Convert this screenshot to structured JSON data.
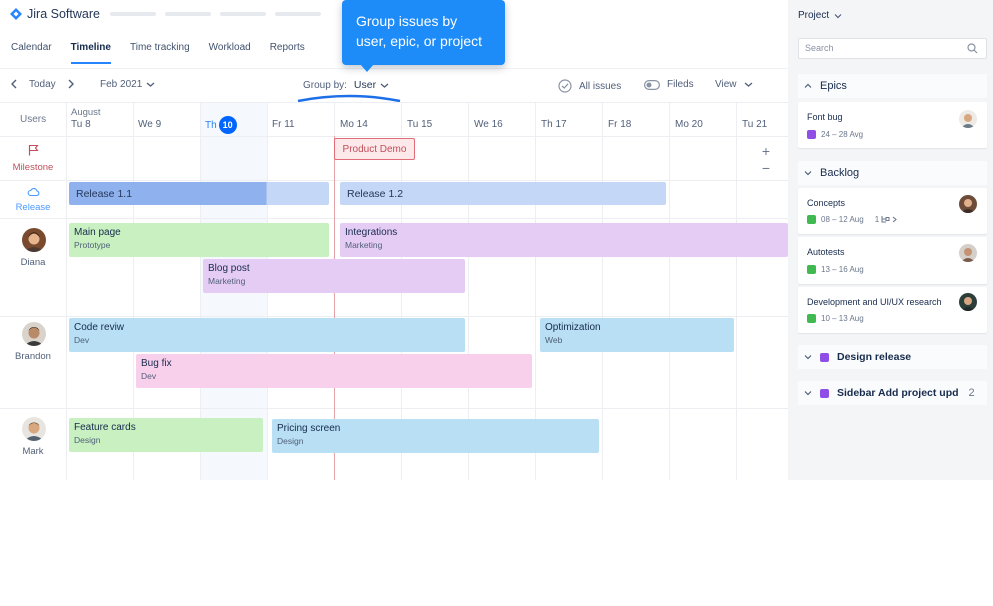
{
  "app": {
    "title": "Jira Software"
  },
  "nav": {
    "tabs": [
      "Calendar",
      "Timeline",
      "Time tracking",
      "Workload",
      "Reports"
    ],
    "active": "Timeline"
  },
  "toolbar": {
    "today": "Today",
    "month": "Feb 2021",
    "group_by_label": "Group by:",
    "group_by_value": "User",
    "all_issues": "All issues",
    "fields": "Fileds",
    "view": "View"
  },
  "tooltip": {
    "text": "Group issues by user, epic, or project"
  },
  "timeline": {
    "users_header": "Users",
    "month_label": "August",
    "days": [
      "Tu 8",
      "We 9",
      "Th",
      "Fr 11",
      "Mo 14",
      "Tu 15",
      "We 16",
      "Th 17",
      "Fr 18",
      "Mo 20",
      "Tu 21"
    ],
    "today_number": "10",
    "milestone_label": "Milestone",
    "release_label": "Release",
    "milestone_name": "Product Demo",
    "zoom_in": "+",
    "zoom_out": "−",
    "releases": [
      "Release 1.1",
      "Release 1.2"
    ],
    "users": [
      "Diana",
      "Brandon",
      "Mark"
    ],
    "bars": [
      {
        "title": "Main page",
        "sub": "Prototype"
      },
      {
        "title": "Integrations",
        "sub": "Marketing"
      },
      {
        "title": "Blog post",
        "sub": "Marketing"
      },
      {
        "title": "Code reviw",
        "sub": "Dev"
      },
      {
        "title": "Optimization",
        "sub": "Web"
      },
      {
        "title": "Bug fix",
        "sub": "Dev"
      },
      {
        "title": "Feature cards",
        "sub": "Design"
      },
      {
        "title": "Pricing screen",
        "sub": "Design"
      }
    ]
  },
  "panel": {
    "project": "Project",
    "search_placeholder": "Search",
    "sections": {
      "epics": "Epics",
      "backlog": "Backlog",
      "design_release": "Design release",
      "sidebar_project": "Sidebar Add project upd",
      "sidebar_count": "2"
    },
    "cards": [
      {
        "title": "Font bug",
        "dates": "24 – 28 Avg"
      },
      {
        "title": "Concepts",
        "dates": "08 – 12 Aug",
        "subtasks": "1"
      },
      {
        "title": "Autotests",
        "dates": "13 – 16 Aug"
      },
      {
        "title": "Development and UI/UX research",
        "dates": "10 – 13 Aug"
      }
    ]
  },
  "colors": {
    "accent": "#2684ff",
    "release": "#a5c3f5",
    "release_dark": "#8fb2ef",
    "green": "#c8f0c0",
    "purple": "#e5ccf5",
    "blue": "#b8dff3",
    "pink": "#f9d0ec",
    "milestone": "#e16d78"
  }
}
